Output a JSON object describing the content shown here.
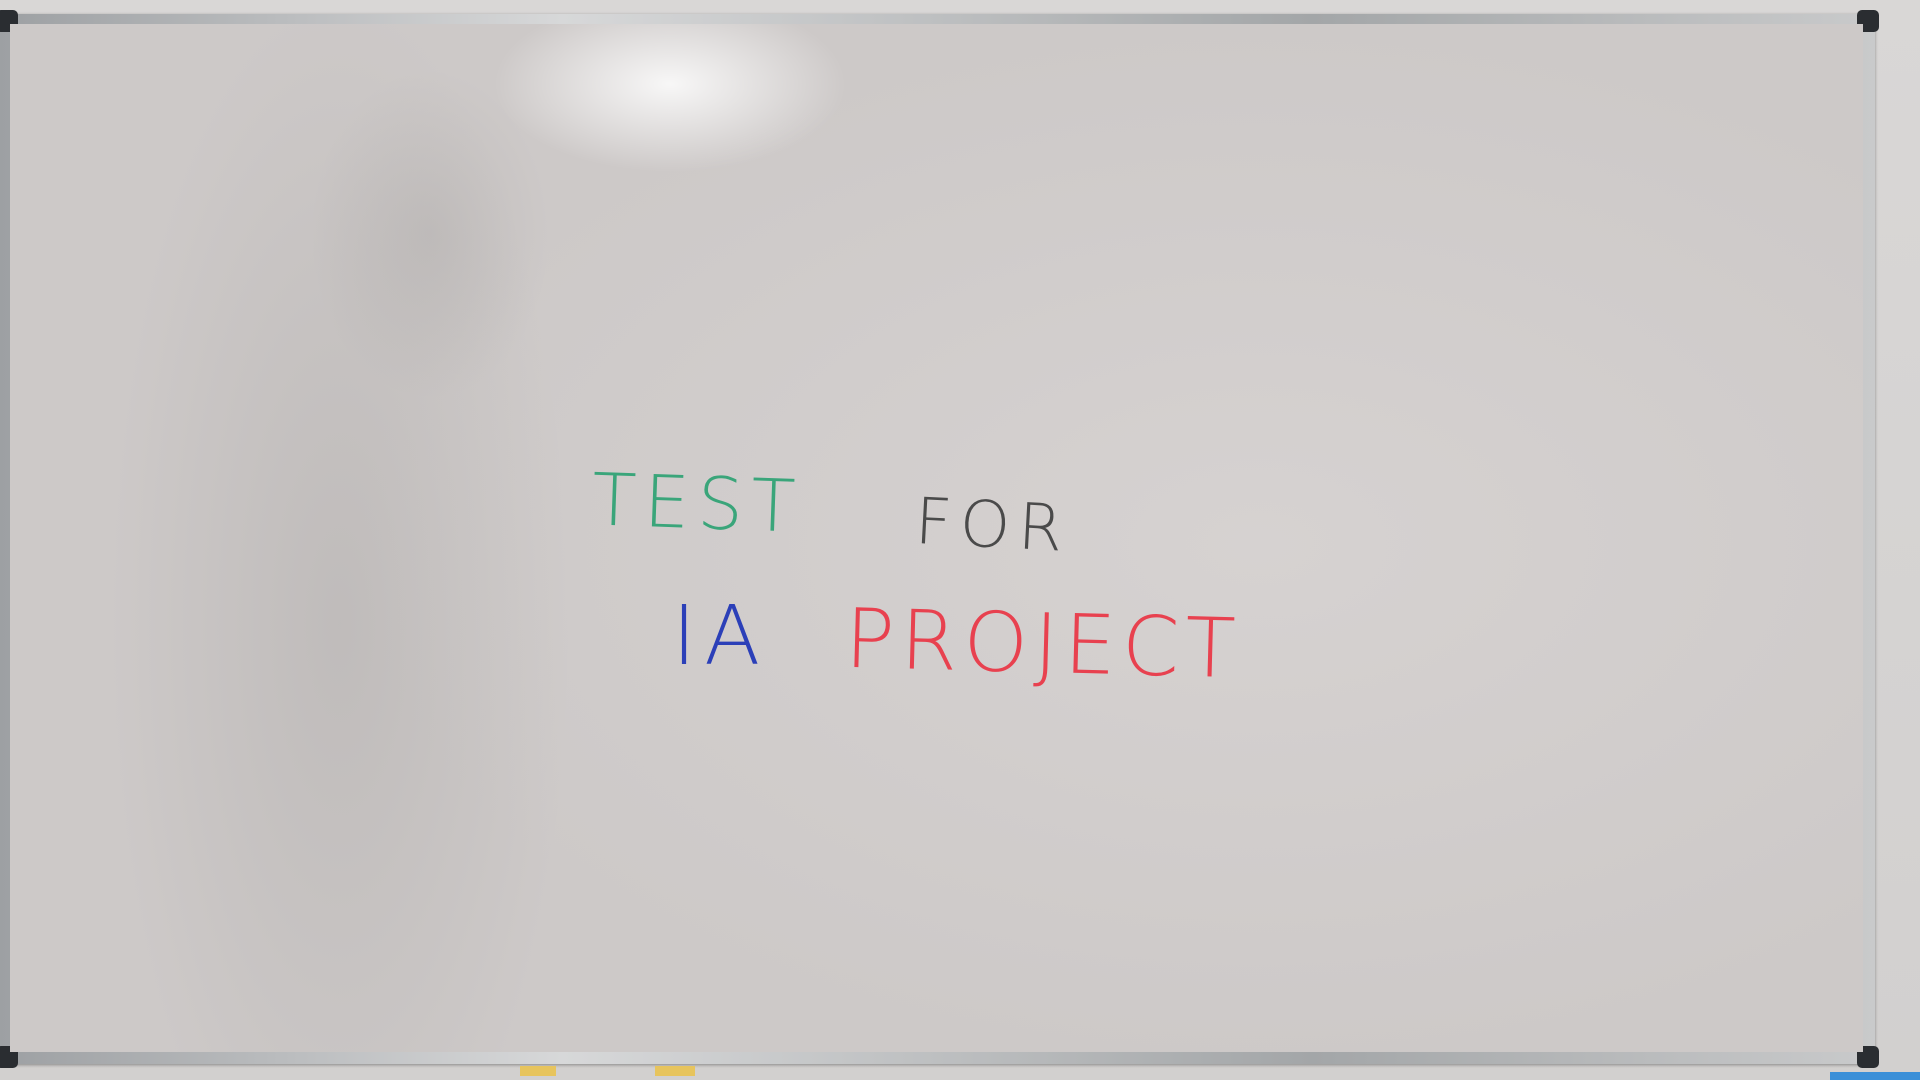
{
  "whiteboard": {
    "line1": [
      {
        "text": "TEST",
        "color": "#3aa57a"
      },
      {
        "text": "FOR",
        "color": "#4a4a4a"
      }
    ],
    "line2": [
      {
        "text": "IA",
        "color": "#2b3fb8"
      },
      {
        "text": "PROJECT",
        "color": "#e8414f"
      }
    ]
  }
}
